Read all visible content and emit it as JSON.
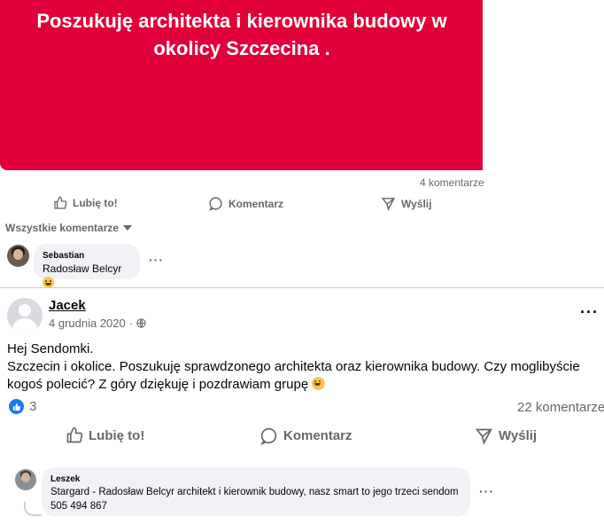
{
  "shared_post": {
    "banner_text": "Poszukuję architekta i kierownika budowy w okolicy Szczecina .",
    "comment_count": "4 komentarze",
    "actions": {
      "like": "Lubię to!",
      "comment": "Komentarz",
      "share": "Wyślij"
    },
    "filter_label": "Wszystkie komentarze",
    "comment": {
      "author": "Sebastian",
      "text": "Radosław Belcyr"
    },
    "banner_color": "#e2003a"
  },
  "post": {
    "author": "Jacek",
    "date": "4 grudnia 2020",
    "text_line1": "Hej Sendomki.",
    "text_line2": "Szczecin i okolice. Poszukuję sprawdzonego architekta oraz kierownika budowy. Czy moglibyście kogoś polecić? Z góry dziękuję i pozdrawiam grupę",
    "reaction_count": "3",
    "comments_count": "22 komentarze",
    "actions": {
      "like": "Lubię to!",
      "comment": "Komentarz",
      "share": "Wyślij"
    },
    "comment": {
      "author": "Leszek",
      "text": "Stargard - Radosław Belcyr architekt i kierownik budowy, nasz smart to jego trzeci sendom 505 494 867"
    }
  },
  "colors": {
    "accent": "#1877f2",
    "muted": "#65676b",
    "bubble": "#f0f2f5"
  }
}
